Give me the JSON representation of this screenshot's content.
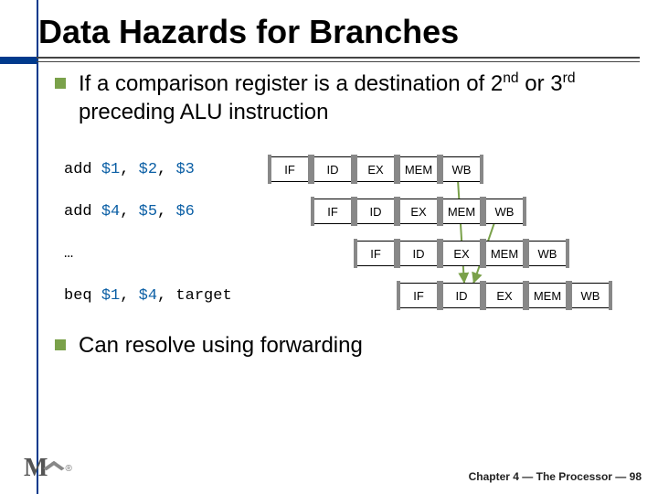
{
  "title": "Data Hazards for Branches",
  "bullets": {
    "b1_pre": "If a comparison register is a destination of 2",
    "b1_sup1": "nd",
    "b1_mid": " or 3",
    "b1_sup2": "rd",
    "b1_post": " preceding ALU instruction",
    "b2": "Can resolve using forwarding"
  },
  "instructions": {
    "i1_op": "add ",
    "i1_r1": "$1",
    "i1_c1": ", ",
    "i1_r2": "$2",
    "i1_c2": ", ",
    "i1_r3": "$3",
    "i2_op": "add ",
    "i2_r1": "$4",
    "i2_c1": ", ",
    "i2_r2": "$5",
    "i2_c2": ", ",
    "i2_r3": "$6",
    "i3": "…",
    "i4_op": "beq ",
    "i4_r1": "$1",
    "i4_c1": ", ",
    "i4_r2": "$4",
    "i4_c2": ", target"
  },
  "stages": {
    "if": "IF",
    "id": "ID",
    "ex": "EX",
    "mem": "MEM",
    "wb": "WB"
  },
  "footer": "Chapter 4 — The Processor — 98"
}
